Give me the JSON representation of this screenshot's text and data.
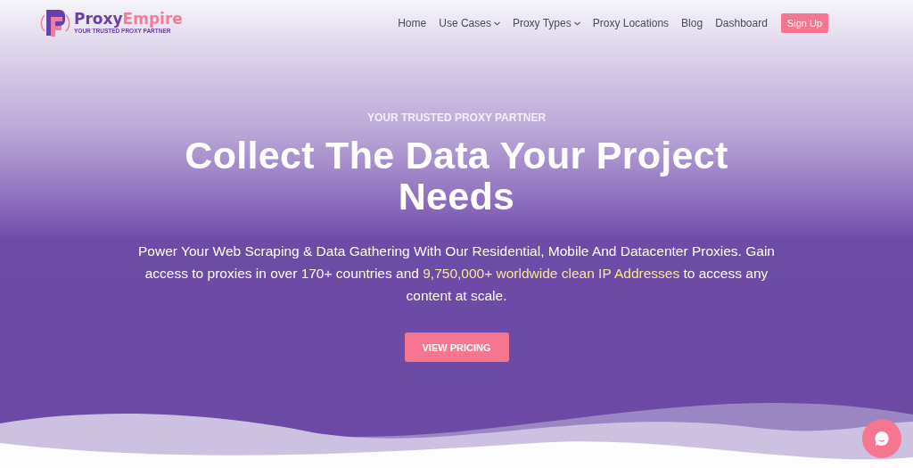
{
  "logo": {
    "name_part1": "Proxy",
    "name_part2": "Empire",
    "tagline": "YOUR TRUSTED PROXY PARTNER"
  },
  "nav": [
    {
      "label": "Home",
      "has_dropdown": false
    },
    {
      "label": "Use Cases",
      "has_dropdown": true
    },
    {
      "label": "Proxy Types",
      "has_dropdown": true
    },
    {
      "label": "Proxy Locations",
      "has_dropdown": false
    },
    {
      "label": "Blog",
      "has_dropdown": false
    },
    {
      "label": "Dashboard",
      "has_dropdown": false
    }
  ],
  "signup_button": "Sign Up",
  "hero": {
    "eyebrow": "YOUR TRUSTED PROXY PARTNER",
    "title": "Collect The Data Your Project Needs",
    "description": {
      "before": "Power Your Web Scraping & Data Gathering With Our Residential, Mobile And Datacenter Proxies. Gain access to proxies in over 170+ countries and ",
      "highlight": "9,750,000+ worldwide clean IP Addresses",
      "after": " to access any content at scale."
    },
    "cta": "VIEW PRICING"
  }
}
